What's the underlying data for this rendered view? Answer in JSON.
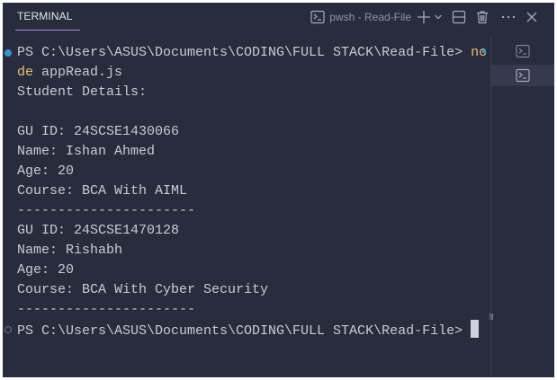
{
  "panel": {
    "tab_label": "TERMINAL",
    "terminal_name": "pwsh - Read-File",
    "icons": [
      "terminal-icon",
      "plus-icon",
      "chevron-down-icon",
      "split-icon",
      "trash-icon",
      "more-icon",
      "close-icon"
    ]
  },
  "terminal": {
    "prompt1": "PS C:\\Users\\ASUS\\Documents\\CODING\\FULL STACK\\Read-File> ",
    "cmd_part1": "no",
    "cmd_part2": "de",
    "cmd_rest": " appRead.js",
    "output": [
      "Student Details:",
      "",
      "GU ID: 24SCSE1430066",
      "Name: Ishan Ahmed",
      "Age: 20",
      "Course: BCA With AIML",
      "----------------------",
      "GU ID: 24SCSE1470128",
      "Name: Rishabh",
      "Age: 20",
      "Course: BCA With Cyber Security",
      "----------------------"
    ],
    "prompt2": "PS C:\\Users\\ASUS\\Documents\\CODING\\FULL STACK\\Read-File> "
  },
  "colors": {
    "background": "#292c3c",
    "command": "#e5c07b",
    "accent": "#3794c9"
  }
}
